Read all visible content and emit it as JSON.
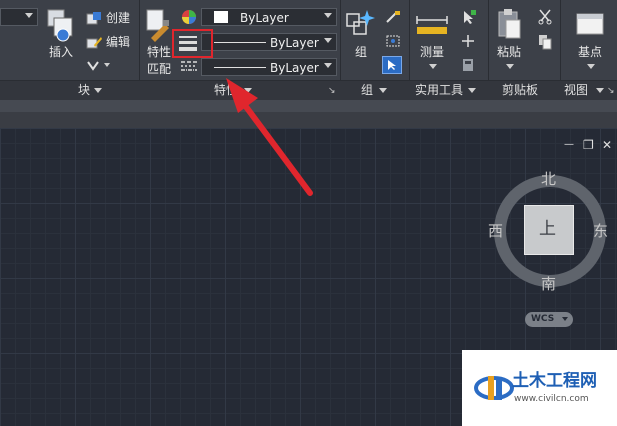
{
  "ribbon": {
    "block_panel": {
      "insert_label": "插入",
      "create_label": "创建",
      "edit_label": "编辑",
      "title": "块"
    },
    "properties_panel": {
      "match_label_line1": "特性",
      "match_label_line2": "匹配",
      "color_value": "ByLayer",
      "lineweight_value": "ByLayer",
      "linetype_value": "ByLayer",
      "title": "特性"
    },
    "groups_panel": {
      "group_label": "组",
      "title": "组"
    },
    "utilities_panel": {
      "measure_label": "测量",
      "title": "实用工具"
    },
    "clipboard_panel": {
      "paste_label": "粘贴",
      "title": "剪贴板"
    },
    "view_panel": {
      "base_label": "基点",
      "title": "视图"
    }
  },
  "viewcube": {
    "north": "北",
    "south": "南",
    "east": "东",
    "west": "西",
    "face": "上",
    "wcs_label": "WCS"
  },
  "window_controls": {
    "minimize": "—",
    "restore": "❐",
    "close": "✕"
  },
  "watermark": {
    "name": "土木工程网",
    "url": "www.civilcn.com"
  },
  "colors": {
    "ribbon_bg": "#3c4048",
    "canvas_bg": "#252a35",
    "highlight": "#e0262d",
    "accent_blue": "#2b6cc4"
  }
}
